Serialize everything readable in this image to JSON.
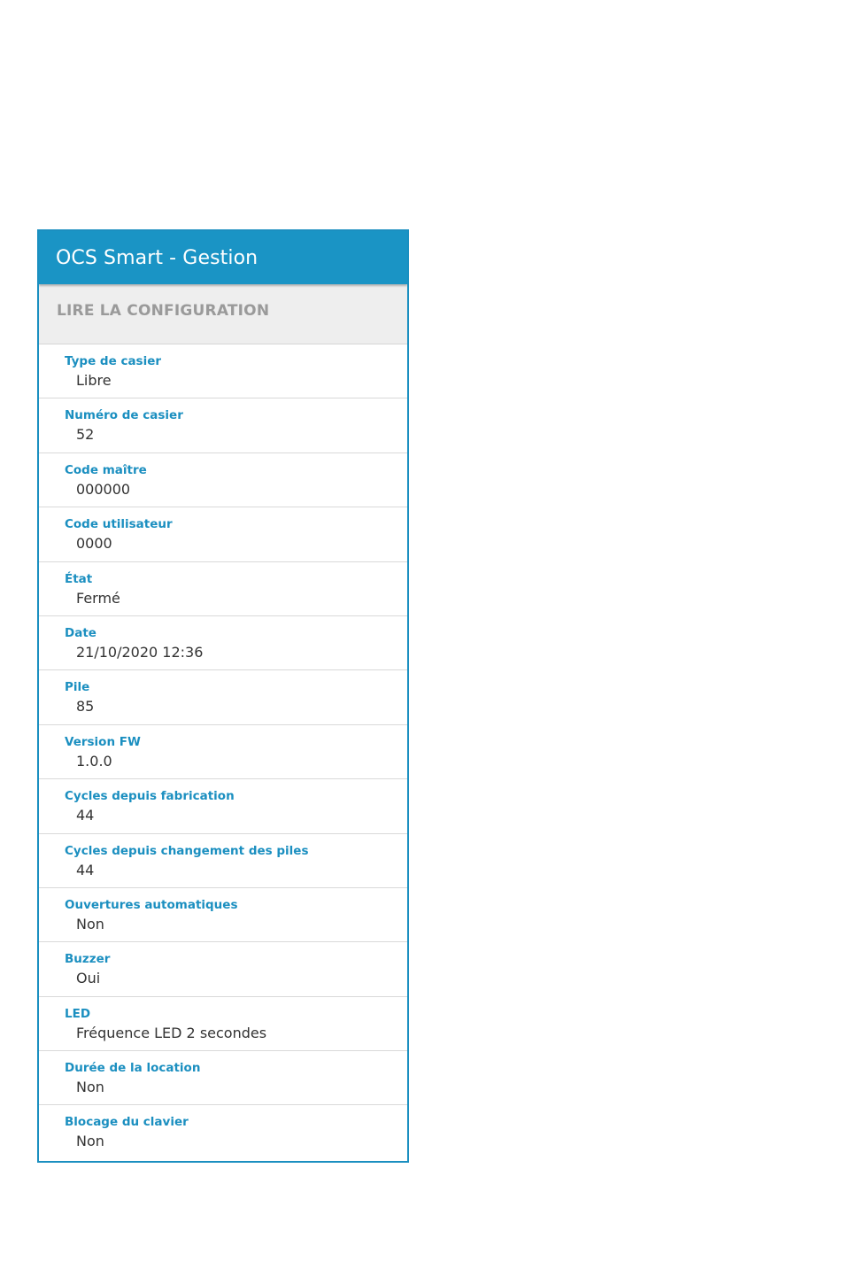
{
  "app": {
    "title": "OCS Smart - Gestion"
  },
  "section": {
    "title": "LIRE LA CONFIGURATION"
  },
  "config": [
    {
      "label": "Type de casier",
      "value": "Libre"
    },
    {
      "label": "Numéro de casier",
      "value": "52"
    },
    {
      "label": "Code maître",
      "value": "000000"
    },
    {
      "label": "Code utilisateur",
      "value": "0000"
    },
    {
      "label": "État",
      "value": "Fermé"
    },
    {
      "label": "Date",
      "value": "21/10/2020 12:36"
    },
    {
      "label": "Pile",
      "value": "85"
    },
    {
      "label": "Version FW",
      "value": "1.0.0"
    },
    {
      "label": "Cycles depuis fabrication",
      "value": "44"
    },
    {
      "label": "Cycles depuis changement des piles",
      "value": "44"
    },
    {
      "label": "Ouvertures automatiques",
      "value": "Non"
    },
    {
      "label": "Buzzer",
      "value": "Oui"
    },
    {
      "label": "LED",
      "value": "Fréquence LED 2 secondes"
    },
    {
      "label": "Durée de la location",
      "value": "Non"
    },
    {
      "label": "Blocage du clavier",
      "value": "Non"
    }
  ],
  "colors": {
    "appbar": "#1a94c5",
    "label": "#1b8fc0",
    "section_header_bg": "#eeeeee",
    "section_header_text": "#9a9a9a"
  }
}
